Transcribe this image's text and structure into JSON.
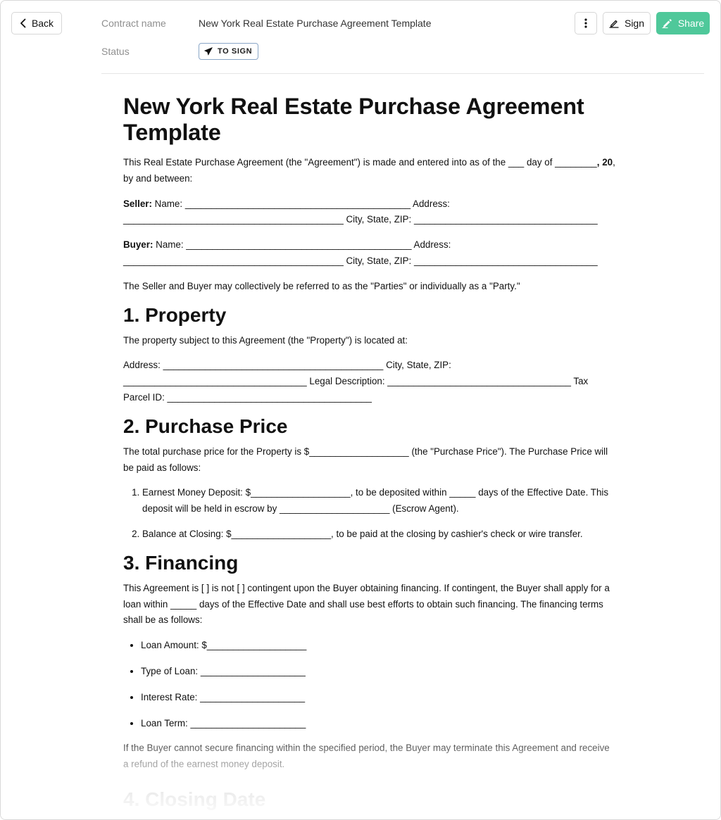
{
  "header": {
    "back_label": "Back",
    "contract_name_label": "Contract name",
    "contract_name_value": "New York Real Estate Purchase Agreement Template",
    "status_label": "Status",
    "status_value": "TO SIGN",
    "more_icon": "vertical-dots-icon",
    "sign_label": "Sign",
    "share_label": "Share",
    "share_color": "#4fc89a"
  },
  "document": {
    "title": "New York Real Estate Purchase Agreement Template",
    "intro_text": "This Real Estate Purchase Agreement (the \"Agreement\") is made and entered into as of the ___ day of ________",
    "intro_bold": ", 20",
    "intro_end": ", by and between:",
    "seller_label": "Seller:",
    "seller_text": " Name: ___________________________________________ Address: __________________________________________ City, State, ZIP: ___________________________________",
    "buyer_label": "Buyer:",
    "buyer_text": " Name: ___________________________________________ Address: __________________________________________ City, State, ZIP: ___________________________________",
    "parties_text": "The Seller and Buyer may collectively be referred to as the \"Parties\" or individually as a \"Party.\"",
    "section1": {
      "heading": "1. Property",
      "p1": "The property subject to this Agreement (the \"Property\") is located at:",
      "p2": "Address: __________________________________________ City, State, ZIP: ___________________________________ Legal Description: ___________________________________ Tax Parcel ID: _______________________________________"
    },
    "section2": {
      "heading": "2. Purchase Price",
      "p1": "The total purchase price for the Property is $___________________ (the \"Purchase Price\"). The Purchase Price will be paid as follows:",
      "items": [
        "Earnest Money Deposit: $___________________, to be deposited within _____ days of the Effective Date. This deposit will be held in escrow by _____________________ (Escrow Agent).",
        "Balance at Closing: $___________________, to be paid at the closing by cashier's check or wire transfer."
      ]
    },
    "section3": {
      "heading": "3. Financing",
      "p1": "This Agreement is [ ] is not [ ] contingent upon the Buyer obtaining financing. If contingent, the Buyer shall apply for a loan within _____ days of the Effective Date and shall use best efforts to obtain such financing. The financing terms shall be as follows:",
      "items": [
        "Loan Amount: $___________________",
        "Type of Loan: ____________________",
        "Interest Rate: ____________________",
        "Loan Term: ______________________"
      ],
      "p2": "If the Buyer cannot secure financing within the specified period, the Buyer may terminate this Agreement and receive a refund of the earnest money deposit."
    },
    "section4": {
      "heading": "4. Closing Date"
    }
  }
}
